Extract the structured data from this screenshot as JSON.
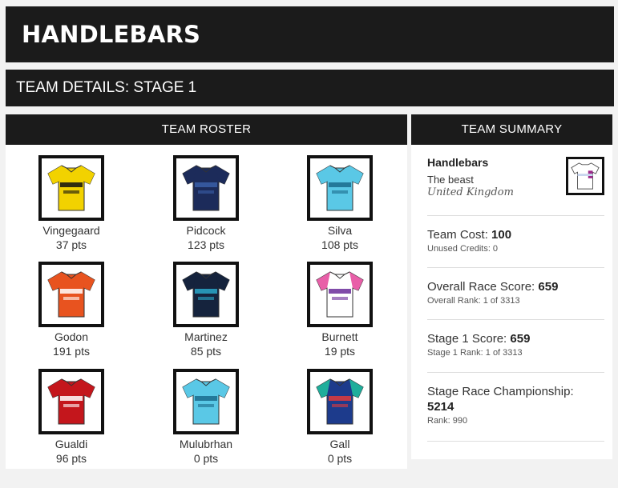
{
  "brand": "HANDLEBARS",
  "stage_title": "TEAM DETAILS: STAGE 1",
  "roster": {
    "heading": "TEAM ROSTER",
    "riders": [
      {
        "name": "Vingegaard",
        "pts": "37 pts",
        "jersey": {
          "body": "#f2d200",
          "accent": "#111111",
          "sleeve": "#f2d200"
        }
      },
      {
        "name": "Pidcock",
        "pts": "123 pts",
        "jersey": {
          "body": "#1c2b5a",
          "accent": "#3a5fa8",
          "sleeve": "#1c2b5a"
        }
      },
      {
        "name": "Silva",
        "pts": "108 pts",
        "jersey": {
          "body": "#5ac8e6",
          "accent": "#1a6b8c",
          "sleeve": "#5ac8e6"
        }
      },
      {
        "name": "Godon",
        "pts": "191 pts",
        "jersey": {
          "body": "#e8531f",
          "accent": "#ffffff",
          "sleeve": "#e8531f"
        }
      },
      {
        "name": "Martinez",
        "pts": "85 pts",
        "jersey": {
          "body": "#15233d",
          "accent": "#2aa7c9",
          "sleeve": "#15233d"
        }
      },
      {
        "name": "Burnett",
        "pts": "19 pts",
        "jersey": {
          "body": "#ffffff",
          "accent": "#6a2b9a",
          "sleeve": "#e85fa8"
        }
      },
      {
        "name": "Gualdi",
        "pts": "96 pts",
        "jersey": {
          "body": "#c4161c",
          "accent": "#ffffff",
          "sleeve": "#c4161c"
        }
      },
      {
        "name": "Mulubrhan",
        "pts": "0 pts",
        "jersey": {
          "body": "#5ac8e6",
          "accent": "#1a6b8c",
          "sleeve": "#5ac8e6"
        }
      },
      {
        "name": "Gall",
        "pts": "0 pts",
        "jersey": {
          "body": "#1d3b8c",
          "accent": "#e23b3b",
          "sleeve": "#1fae9b"
        }
      }
    ]
  },
  "summary": {
    "heading": "TEAM SUMMARY",
    "team_name": "Handlebars",
    "owner": "The beast",
    "country": "United Kingdom",
    "team_cost_label": "Team Cost:",
    "team_cost": "100",
    "unused_credits": "Unused Credits: 0",
    "overall_label": "Overall Race Score:",
    "overall_score": "659",
    "overall_rank": "Overall Rank: 1 of 3313",
    "stage_label": "Stage 1 Score:",
    "stage_score": "659",
    "stage_rank": "Stage 1 Rank: 1 of 3313",
    "champ_label": "Stage Race Championship:",
    "champ_score": "5214",
    "champ_rank": "Rank: 990"
  },
  "colors": {
    "dark": "#1b1b1b",
    "page_bg": "#f2f2f2"
  }
}
